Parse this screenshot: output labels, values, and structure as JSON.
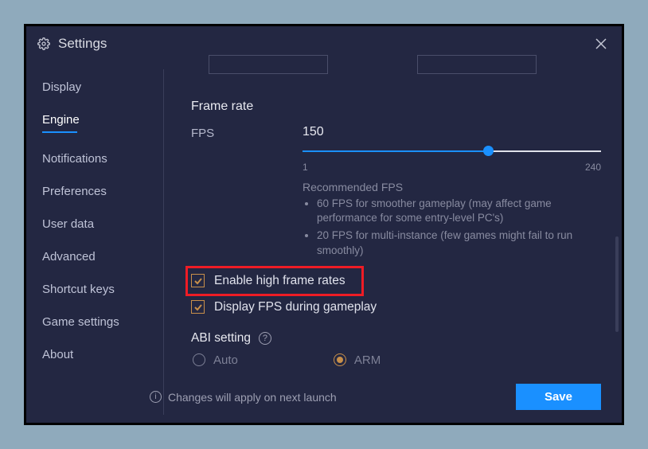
{
  "window": {
    "title": "Settings"
  },
  "sidebar": {
    "items": [
      {
        "label": "Display"
      },
      {
        "label": "Engine"
      },
      {
        "label": "Notifications"
      },
      {
        "label": "Preferences"
      },
      {
        "label": "User data"
      },
      {
        "label": "Advanced"
      },
      {
        "label": "Shortcut keys"
      },
      {
        "label": "Game settings"
      },
      {
        "label": "About"
      }
    ],
    "active_index": 1
  },
  "content": {
    "frame_rate": {
      "title": "Frame rate",
      "fps_label": "FPS",
      "fps_value": "150",
      "min": "1",
      "max": "240",
      "recommended_title": "Recommended FPS",
      "recommended": [
        "60 FPS for smoother gameplay (may affect game performance for some entry-level PC's)",
        "20 FPS for multi-instance (few games might fail to run smoothly)"
      ],
      "enable_high": {
        "label": "Enable high frame rates",
        "checked": true
      },
      "display_fps": {
        "label": "Display FPS during gameplay",
        "checked": true
      }
    },
    "abi": {
      "title": "ABI setting",
      "options": [
        {
          "label": "Auto",
          "selected": false
        },
        {
          "label": "ARM",
          "selected": true
        }
      ]
    }
  },
  "footer": {
    "note": "Changes will apply on next launch",
    "save": "Save"
  }
}
